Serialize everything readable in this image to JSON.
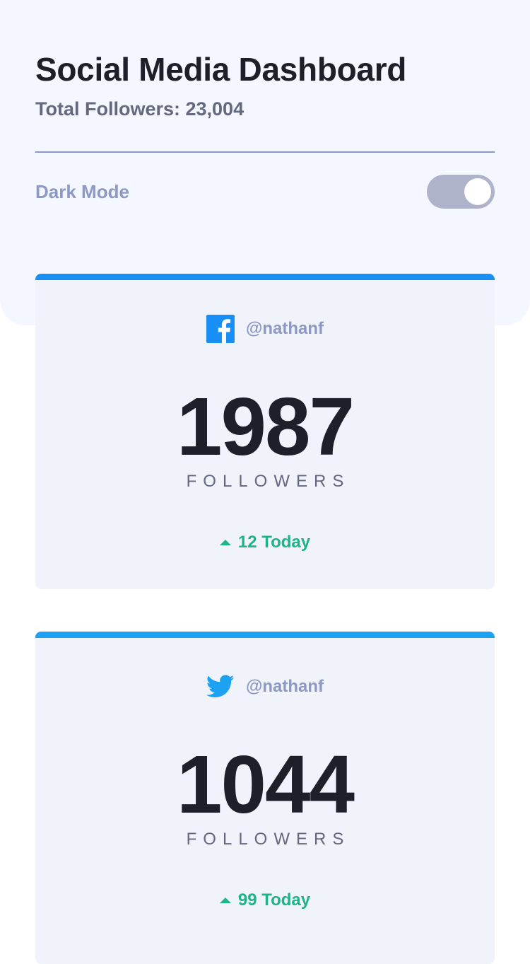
{
  "header": {
    "title": "Social Media Dashboard",
    "total_followers": "Total Followers: 23,004"
  },
  "dark_mode": {
    "label": "Dark Mode",
    "enabled": false
  },
  "cards": [
    {
      "platform": "facebook",
      "icon": "facebook-icon",
      "accent_color": "#198ff5",
      "handle": "@nathanf",
      "count": "1987",
      "label": "FOLLOWERS",
      "today": "12 Today",
      "trend": "up"
    },
    {
      "platform": "twitter",
      "icon": "twitter-icon",
      "accent_color": "#1da1f2",
      "handle": "@nathanf",
      "count": "1044",
      "label": "FOLLOWERS",
      "today": "99 Today",
      "trend": "up"
    }
  ],
  "colors": {
    "up": "#1db489",
    "muted_text": "#8c98c6",
    "card_bg": "#f0f3fa"
  }
}
